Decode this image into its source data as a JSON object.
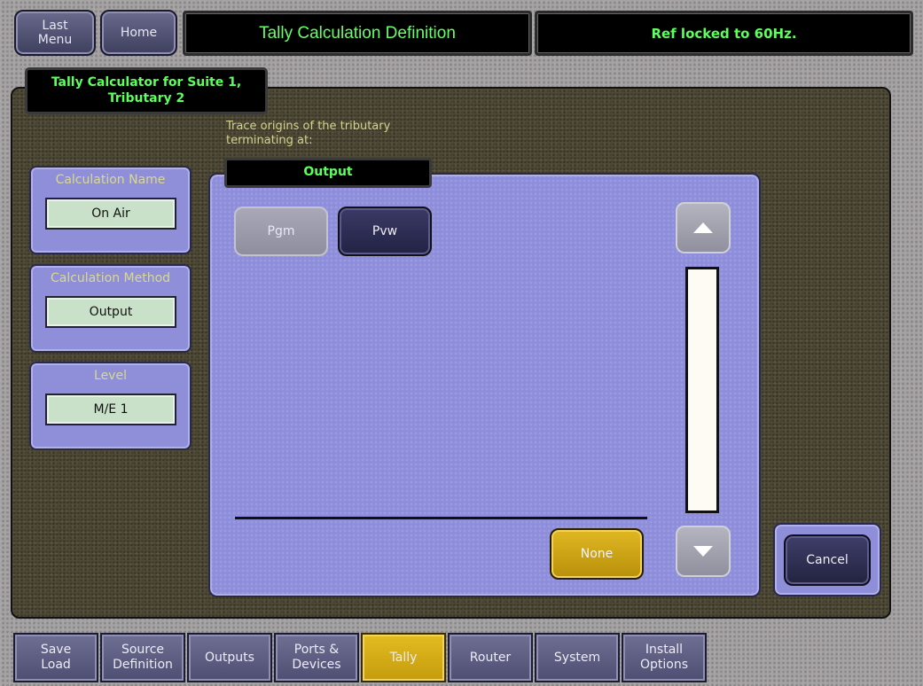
{
  "header": {
    "last_menu": "Last\nMenu",
    "home": "Home",
    "title": "Tally Calculation Definition",
    "status": "Ref locked to 60Hz."
  },
  "suite_label": "Tally Calculator for Suite 1,\nTributary 2",
  "fields": {
    "calc_name_label": "Calculation Name",
    "calc_name_value": "On Air",
    "calc_method_label": "Calculation Method",
    "calc_method_value": "Output",
    "level_label": "Level",
    "level_value": "M/E 1"
  },
  "trace": "Trace origins of the tributary\nterminating at:",
  "output_header": "Output",
  "sources": [
    {
      "label": "Pgm",
      "selected": false
    },
    {
      "label": "Pvw",
      "selected": true
    }
  ],
  "icons": {
    "scroll_up": "scroll-up-arrow",
    "scroll_down": "scroll-down-arrow"
  },
  "buttons": {
    "none": "None",
    "cancel": "Cancel"
  },
  "tabs": [
    {
      "label": "Save\nLoad",
      "active": false
    },
    {
      "label": "Source\nDefinition",
      "active": false
    },
    {
      "label": "Outputs",
      "active": false
    },
    {
      "label": "Ports &\nDevices",
      "active": false
    },
    {
      "label": "Tally",
      "active": true
    },
    {
      "label": "Router",
      "active": false
    },
    {
      "label": "System",
      "active": false
    },
    {
      "label": "Install\nOptions",
      "active": false
    }
  ],
  "colors": {
    "status_green": "#5cff5c",
    "title_green": "#66ff66",
    "active_tab": "#e3bc22",
    "panel_lavender": "#8d8ddb"
  }
}
